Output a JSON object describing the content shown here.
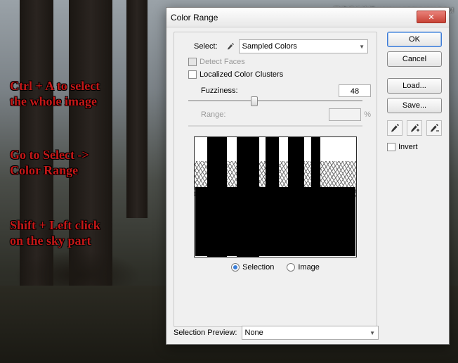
{
  "watermark": "思缘设计论坛  WWW.MISSYUAN.COM",
  "annotations": {
    "a1": "Ctrl + A to select\nthe whole image",
    "a2": "Go to Select ->\nColor Range",
    "a3": "Shift + Left click\non the sky part"
  },
  "dialog": {
    "title": "Color Range",
    "select_label": "Select:",
    "select_value": "Sampled Colors",
    "detect_faces": "Detect Faces",
    "localized": "Localized Color Clusters",
    "fuzziness_label": "Fuzziness:",
    "fuzziness_value": "48",
    "range_label": "Range:",
    "range_value": "",
    "range_unit": "%",
    "radio_selection": "Selection",
    "radio_image": "Image",
    "selection_preview_label": "Selection Preview:",
    "selection_preview_value": "None",
    "buttons": {
      "ok": "OK",
      "cancel": "Cancel",
      "load": "Load...",
      "save": "Save..."
    },
    "invert_label": "Invert"
  }
}
